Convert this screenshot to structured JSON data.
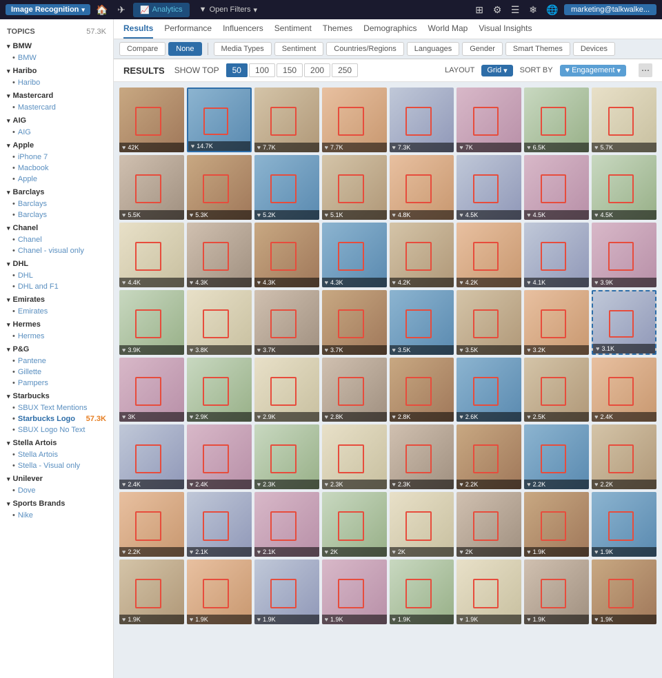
{
  "topnav": {
    "brand": "Image Recognition",
    "analytics": "Analytics",
    "open_filters": "Open Filters",
    "user": "marketing@talkwalke..."
  },
  "secondary_nav": {
    "tabs": [
      "Results",
      "Performance",
      "Influencers",
      "Sentiment",
      "Themes",
      "Demographics",
      "World Map",
      "Visual Insights"
    ]
  },
  "filter_bar": {
    "compare": "Compare",
    "none": "None",
    "media_types": "Media Types",
    "sentiment": "Sentiment",
    "countries_regions": "Countries/Regions",
    "languages": "Languages",
    "gender": "Gender",
    "smart_themes": "Smart Themes",
    "devices": "Devices"
  },
  "results_toolbar": {
    "results_label": "RESULTS",
    "show_top_label": "SHOW TOP",
    "options": [
      "50",
      "100",
      "150",
      "200",
      "250"
    ],
    "active_option": "50",
    "layout_label": "LAYOUT",
    "layout_value": "Grid",
    "sort_label": "SORT BY",
    "sort_value": "Engagement"
  },
  "sidebar": {
    "topics_label": "TOPICS",
    "count": "57.3K",
    "groups": [
      {
        "name": "BMW",
        "items": [
          {
            "label": "BMW",
            "count": null
          }
        ]
      },
      {
        "name": "Haribo",
        "items": [
          {
            "label": "Haribo",
            "count": null
          }
        ]
      },
      {
        "name": "Mastercard",
        "items": [
          {
            "label": "Mastercard",
            "count": null
          }
        ]
      },
      {
        "name": "AIG",
        "items": [
          {
            "label": "AIG",
            "count": null
          }
        ]
      },
      {
        "name": "Apple",
        "items": [
          {
            "label": "iPhone 7",
            "count": null
          },
          {
            "label": "Macbook",
            "count": null
          },
          {
            "label": "Apple",
            "count": null
          }
        ]
      },
      {
        "name": "Barclays",
        "items": [
          {
            "label": "Barclays",
            "count": null
          },
          {
            "label": "Barclays",
            "count": null
          }
        ]
      },
      {
        "name": "Chanel",
        "items": [
          {
            "label": "Chanel",
            "count": null
          },
          {
            "label": "Chanel - visual only",
            "count": null
          }
        ]
      },
      {
        "name": "DHL",
        "items": [
          {
            "label": "DHL",
            "count": null
          },
          {
            "label": "DHL and F1",
            "count": null
          }
        ]
      },
      {
        "name": "Emirates",
        "items": [
          {
            "label": "Emirates",
            "count": null
          }
        ]
      },
      {
        "name": "Hermes",
        "items": [
          {
            "label": "Hermes",
            "count": null
          }
        ]
      },
      {
        "name": "P&G",
        "items": [
          {
            "label": "Pantene",
            "count": null
          },
          {
            "label": "Gillette",
            "count": null
          },
          {
            "label": "Pampers",
            "count": null
          }
        ]
      },
      {
        "name": "Starbucks",
        "items": [
          {
            "label": "SBUX Text Mentions",
            "count": null
          },
          {
            "label": "Starbucks Logo",
            "count": "57.3K"
          },
          {
            "label": "SBUX Logo No Text",
            "count": null
          }
        ]
      },
      {
        "name": "Stella Artois",
        "items": [
          {
            "label": "Stella Artois",
            "count": null
          },
          {
            "label": "Stella - Visual only",
            "count": null
          }
        ]
      },
      {
        "name": "Unilever",
        "items": [
          {
            "label": "Dove",
            "count": null
          }
        ]
      },
      {
        "name": "Sports Brands",
        "items": [
          {
            "label": "Nike",
            "count": null
          }
        ]
      }
    ]
  },
  "images": [
    {
      "badge": "42K",
      "swatch": "swatch-1",
      "selected": false
    },
    {
      "badge": "14.7K",
      "swatch": "swatch-2",
      "selected": true
    },
    {
      "badge": "7.7K",
      "swatch": "swatch-3",
      "selected": false
    },
    {
      "badge": "7.7K",
      "swatch": "swatch-4",
      "selected": false
    },
    {
      "badge": "7.3K",
      "swatch": "swatch-5",
      "selected": false
    },
    {
      "badge": "7K",
      "swatch": "swatch-6",
      "selected": false
    },
    {
      "badge": "6.5K",
      "swatch": "swatch-7",
      "selected": false
    },
    {
      "badge": "5.7K",
      "swatch": "swatch-8",
      "selected": false
    },
    {
      "badge": "5.5K",
      "swatch": "swatch-9",
      "selected": false
    },
    {
      "badge": "5.3K",
      "swatch": "swatch-1",
      "selected": false
    },
    {
      "badge": "5.2K",
      "swatch": "swatch-2",
      "selected": false
    },
    {
      "badge": "5.1K",
      "swatch": "swatch-3",
      "selected": false
    },
    {
      "badge": "4.8K",
      "swatch": "swatch-4",
      "selected": false
    },
    {
      "badge": "4.5K",
      "swatch": "swatch-5",
      "selected": false
    },
    {
      "badge": "4.5K",
      "swatch": "swatch-6",
      "selected": false
    },
    {
      "badge": "4.5K",
      "swatch": "swatch-7",
      "selected": false
    },
    {
      "badge": "4.4K",
      "swatch": "swatch-8",
      "selected": false
    },
    {
      "badge": "4.3K",
      "swatch": "swatch-9",
      "selected": false
    },
    {
      "badge": "4.3K",
      "swatch": "swatch-1",
      "selected": false
    },
    {
      "badge": "4.3K",
      "swatch": "swatch-2",
      "selected": false
    },
    {
      "badge": "4.2K",
      "swatch": "swatch-3",
      "selected": false
    },
    {
      "badge": "4.2K",
      "swatch": "swatch-4",
      "selected": false
    },
    {
      "badge": "4.1K",
      "swatch": "swatch-5",
      "selected": false
    },
    {
      "badge": "3.9K",
      "swatch": "swatch-6",
      "selected": false
    },
    {
      "badge": "3.9K",
      "swatch": "swatch-7",
      "selected": false
    },
    {
      "badge": "3.8K",
      "swatch": "swatch-8",
      "selected": false
    },
    {
      "badge": "3.7K",
      "swatch": "swatch-9",
      "selected": false
    },
    {
      "badge": "3.7K",
      "swatch": "swatch-1",
      "selected": false
    },
    {
      "badge": "3.5K",
      "swatch": "swatch-2",
      "selected": false
    },
    {
      "badge": "3.5K",
      "swatch": "swatch-3",
      "selected": false
    },
    {
      "badge": "3.2K",
      "swatch": "swatch-4",
      "selected": false
    },
    {
      "badge": "3.1K",
      "swatch": "swatch-5",
      "selected": true,
      "dashed": true
    },
    {
      "badge": "3K",
      "swatch": "swatch-6",
      "selected": false
    },
    {
      "badge": "2.9K",
      "swatch": "swatch-7",
      "selected": false
    },
    {
      "badge": "2.9K",
      "swatch": "swatch-8",
      "selected": false
    },
    {
      "badge": "2.8K",
      "swatch": "swatch-9",
      "selected": false
    },
    {
      "badge": "2.8K",
      "swatch": "swatch-1",
      "selected": false
    },
    {
      "badge": "2.6K",
      "swatch": "swatch-2",
      "selected": false
    },
    {
      "badge": "2.5K",
      "swatch": "swatch-3",
      "selected": false
    },
    {
      "badge": "2.4K",
      "swatch": "swatch-4",
      "selected": false
    },
    {
      "badge": "2.4K",
      "swatch": "swatch-5",
      "selected": false
    },
    {
      "badge": "2.4K",
      "swatch": "swatch-6",
      "selected": false
    },
    {
      "badge": "2.3K",
      "swatch": "swatch-7",
      "selected": false
    },
    {
      "badge": "2.3K",
      "swatch": "swatch-8",
      "selected": false
    },
    {
      "badge": "2.3K",
      "swatch": "swatch-9",
      "selected": false
    },
    {
      "badge": "2.2K",
      "swatch": "swatch-1",
      "selected": false
    },
    {
      "badge": "2.2K",
      "swatch": "swatch-2",
      "selected": false
    },
    {
      "badge": "2.2K",
      "swatch": "swatch-3",
      "selected": false
    },
    {
      "badge": "2.2K",
      "swatch": "swatch-4",
      "selected": false
    },
    {
      "badge": "2.1K",
      "swatch": "swatch-5",
      "selected": false
    },
    {
      "badge": "2.1K",
      "swatch": "swatch-6",
      "selected": false
    },
    {
      "badge": "2K",
      "swatch": "swatch-7",
      "selected": false
    },
    {
      "badge": "2K",
      "swatch": "swatch-8",
      "selected": false
    },
    {
      "badge": "2K",
      "swatch": "swatch-9",
      "selected": false
    },
    {
      "badge": "1.9K",
      "swatch": "swatch-1",
      "selected": false
    },
    {
      "badge": "1.9K",
      "swatch": "swatch-2",
      "selected": false
    },
    {
      "badge": "1.9K",
      "swatch": "swatch-3",
      "selected": false
    },
    {
      "badge": "1.9K",
      "swatch": "swatch-4",
      "selected": false
    },
    {
      "badge": "1.9K",
      "swatch": "swatch-5",
      "selected": false
    },
    {
      "badge": "1.9K",
      "swatch": "swatch-6",
      "selected": false
    },
    {
      "badge": "1.9K",
      "swatch": "swatch-7",
      "selected": false
    },
    {
      "badge": "1.9K",
      "swatch": "swatch-8",
      "selected": false
    },
    {
      "badge": "1.9K",
      "swatch": "swatch-9",
      "selected": false
    },
    {
      "badge": "1.9K",
      "swatch": "swatch-1",
      "selected": false
    }
  ]
}
